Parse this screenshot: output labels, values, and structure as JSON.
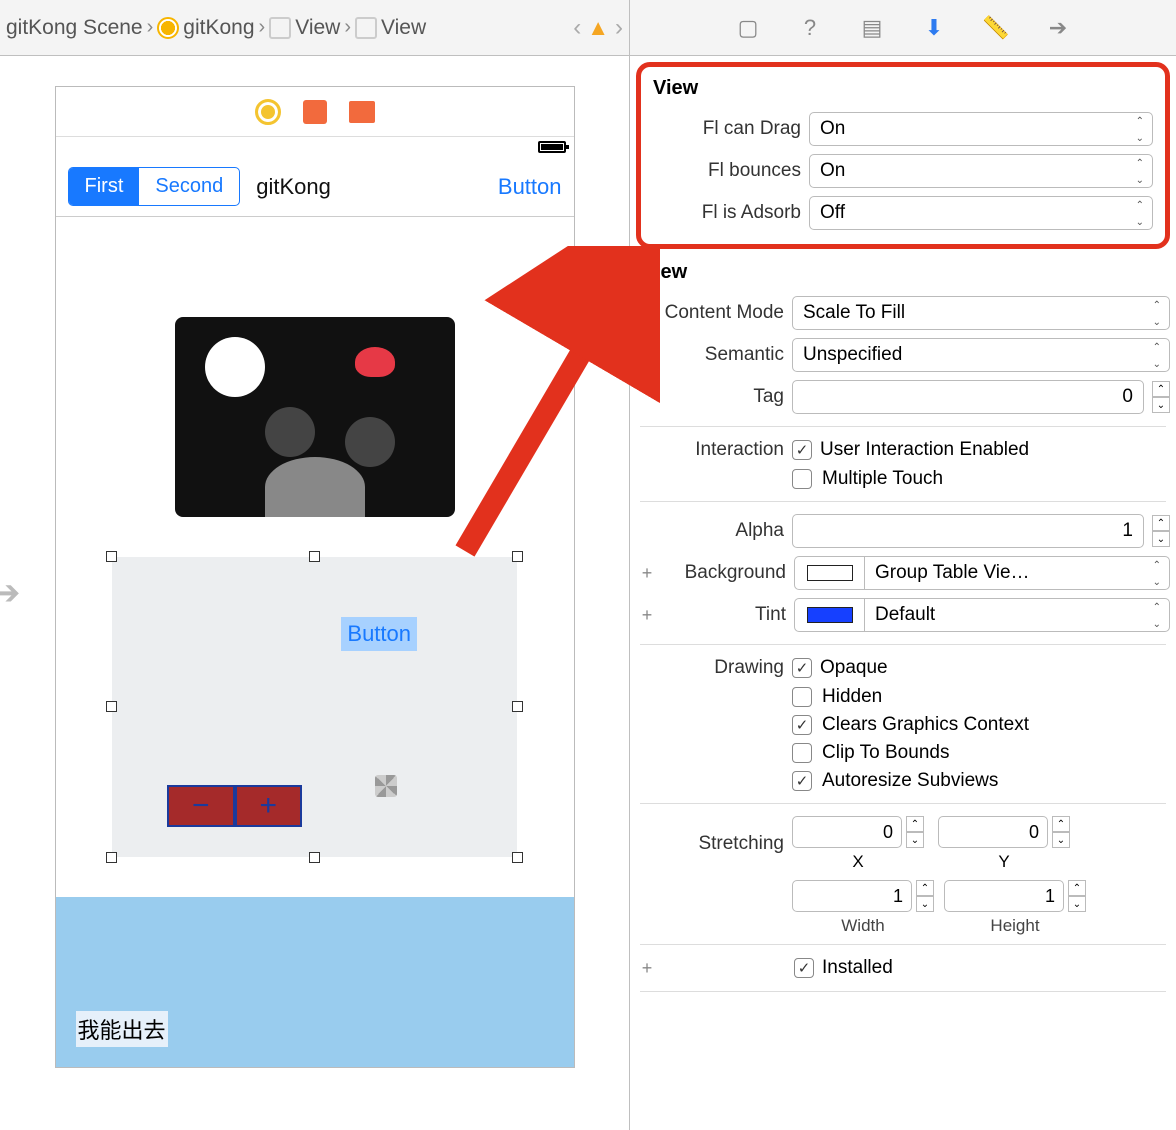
{
  "breadcrumb": {
    "scene": "gitKong Scene",
    "vc": "gitKong",
    "view1": "View",
    "view2": "View"
  },
  "phone": {
    "seg_first": "First",
    "seg_second": "Second",
    "title": "gitKong",
    "nav_button": "Button",
    "inner_button": "Button",
    "stepper_minus": "−",
    "stepper_plus": "+",
    "cn_label": "我能出去"
  },
  "highlight": {
    "title": "View",
    "can_drag_label": "Fl can Drag",
    "can_drag_value": "On",
    "bounces_label": "Fl bounces",
    "bounces_value": "On",
    "adsorb_label": "Fl is Adsorb",
    "adsorb_value": "Off"
  },
  "inspector": {
    "title": "View",
    "content_mode_label": "Content Mode",
    "content_mode_value": "Scale To Fill",
    "semantic_label": "Semantic",
    "semantic_value": "Unspecified",
    "tag_label": "Tag",
    "tag_value": "0",
    "interaction_label": "Interaction",
    "user_interaction": "User Interaction Enabled",
    "multiple_touch": "Multiple Touch",
    "alpha_label": "Alpha",
    "alpha_value": "1",
    "background_label": "Background",
    "background_value": "Group Table Vie…",
    "tint_label": "Tint",
    "tint_value": "Default",
    "drawing_label": "Drawing",
    "opaque": "Opaque",
    "hidden": "Hidden",
    "clears": "Clears Graphics Context",
    "clip": "Clip To Bounds",
    "autoresize": "Autoresize Subviews",
    "stretch_label": "Stretching",
    "stretch_x": "0",
    "stretch_x_cap": "X",
    "stretch_y": "0",
    "stretch_y_cap": "Y",
    "stretch_w": "1",
    "stretch_w_cap": "Width",
    "stretch_h": "1",
    "stretch_h_cap": "Height",
    "installed": "Installed"
  },
  "colors": {
    "background_swatch": "#ffffff",
    "tint_swatch": "#1640ff"
  }
}
